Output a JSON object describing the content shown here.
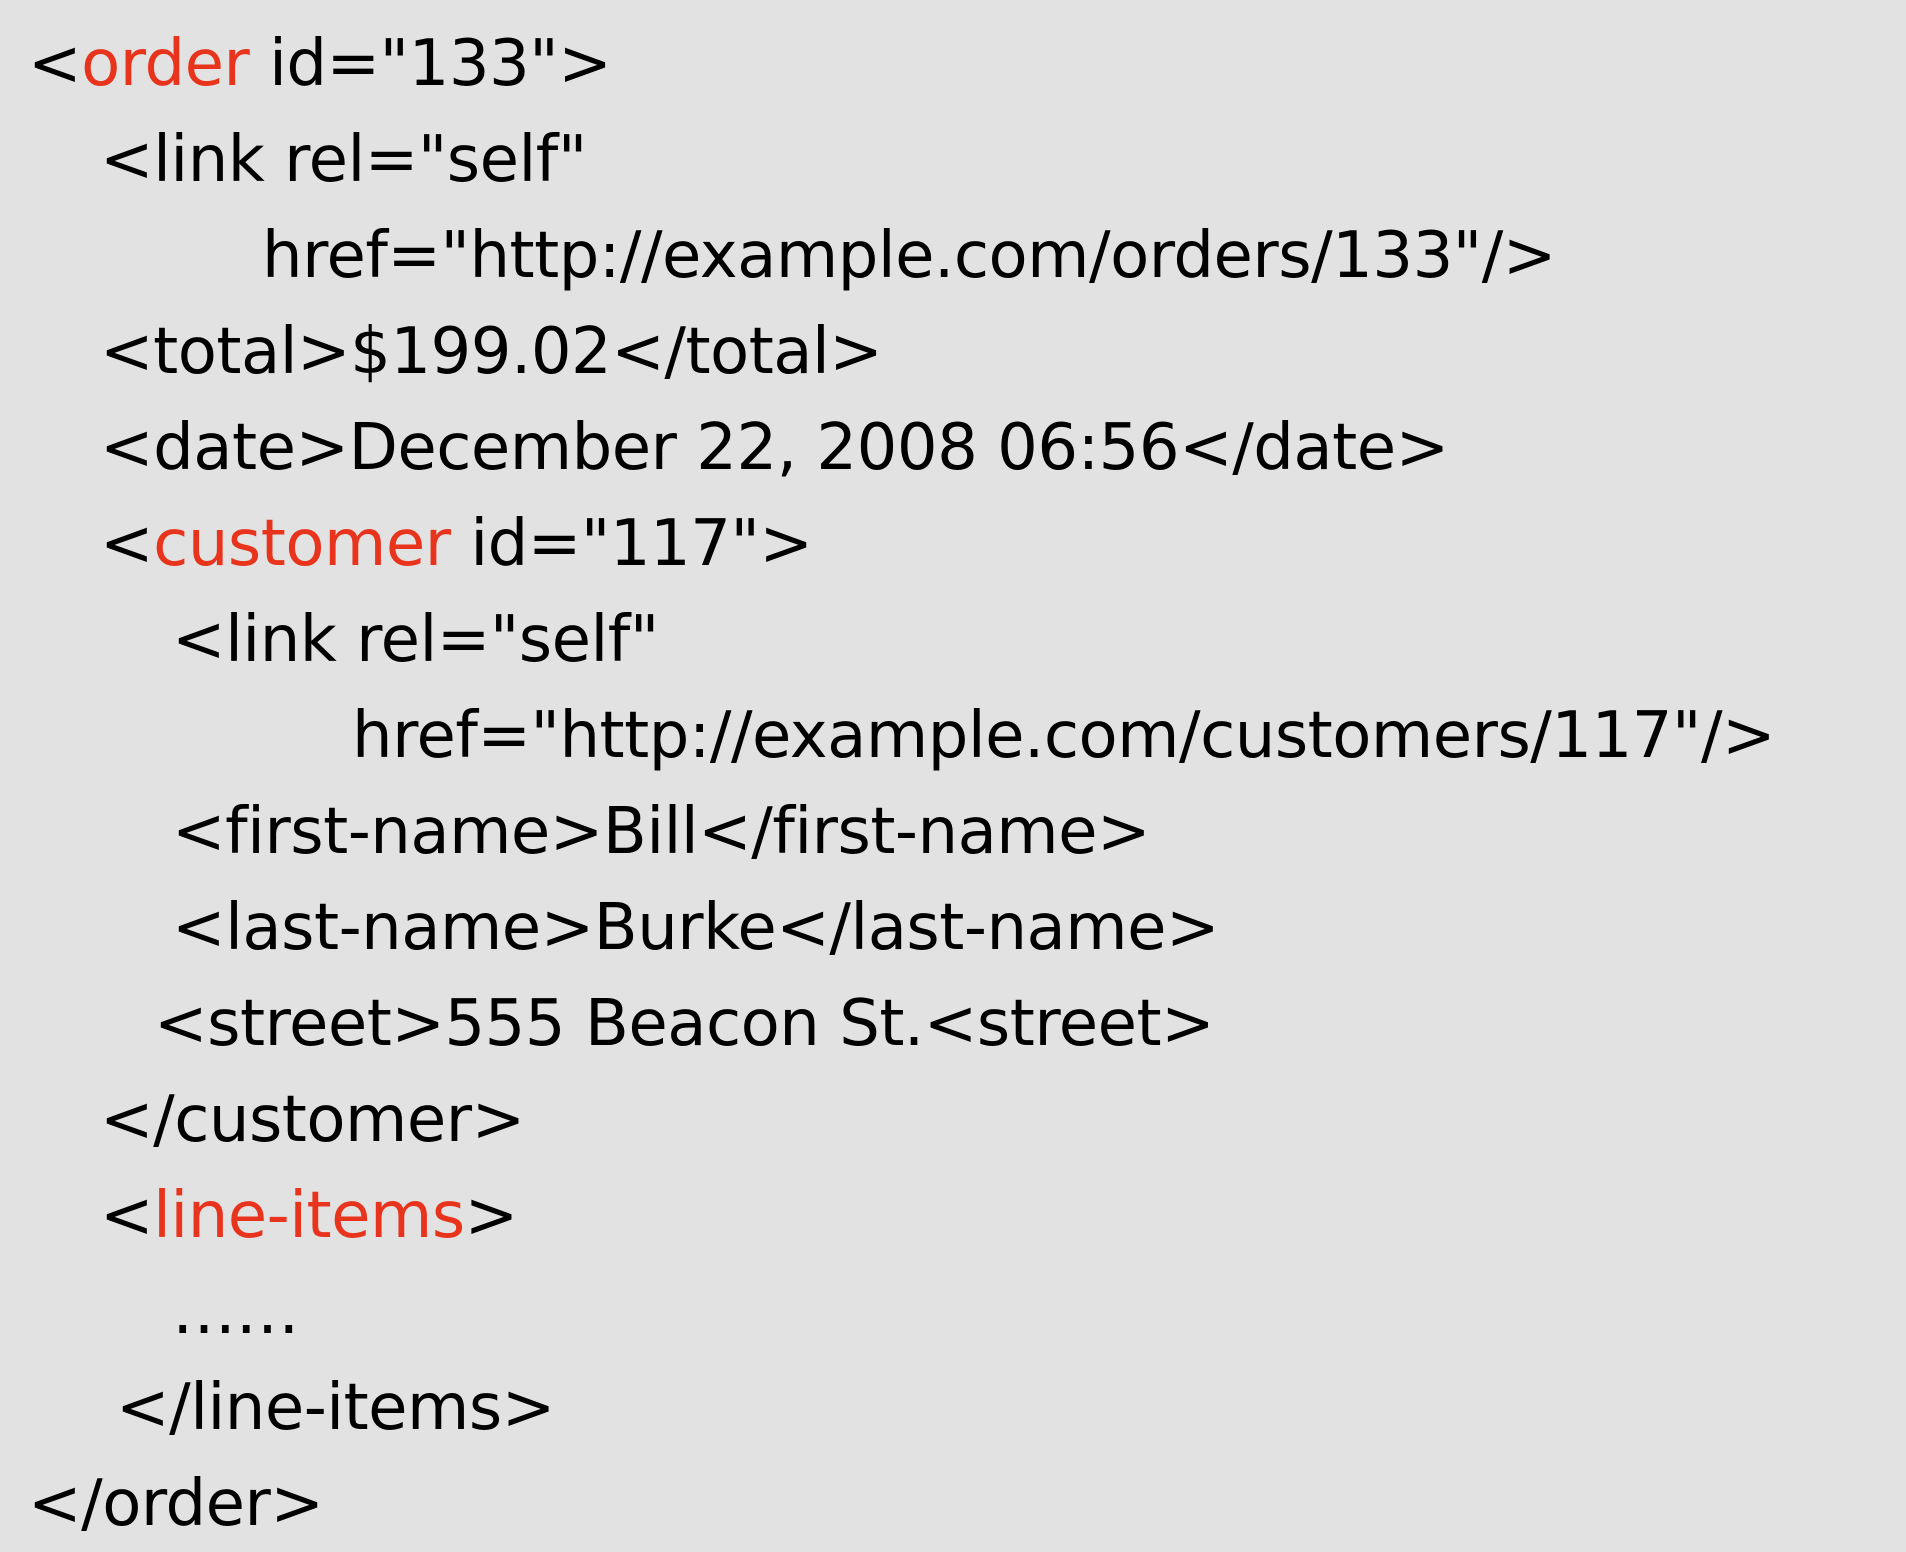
{
  "colors": {
    "background": "#e2e2e2",
    "text": "#000000",
    "highlight": "#e8341c"
  },
  "lines": [
    {
      "pre": "<",
      "kw": "order",
      "post": " id=\"133\">"
    },
    {
      "pre": "<link rel=\"self\"",
      "kw": "",
      "post": ""
    },
    {
      "pre": "href=\"http://example.com/orders/133\"/>",
      "kw": "",
      "post": ""
    },
    {
      "pre": "<total>$199.02</total>",
      "kw": "",
      "post": ""
    },
    {
      "pre": "<date>December 22, 2008 06:56</date>",
      "kw": "",
      "post": ""
    },
    {
      "pre": "<",
      "kw": "customer",
      "post": " id=\"117\">"
    },
    {
      "pre": "<link rel=\"self\"",
      "kw": "",
      "post": ""
    },
    {
      "pre": "href=\"http://example.com/customers/117\"/>",
      "kw": "",
      "post": ""
    },
    {
      "pre": "<first-name>Bill</first-name>",
      "kw": "",
      "post": ""
    },
    {
      "pre": "<last-name>Burke</last-name>",
      "kw": "",
      "post": ""
    },
    {
      "pre": "<street>555 Beacon St.<street>",
      "kw": "",
      "post": ""
    },
    {
      "pre": "</customer>",
      "kw": "",
      "post": ""
    },
    {
      "pre": "<",
      "kw": "line-items",
      "post": ">"
    },
    {
      "pre": "……",
      "kw": "",
      "post": ""
    },
    {
      "pre": "</line-items>",
      "kw": "",
      "post": ""
    },
    {
      "pre": "</order>",
      "kw": "",
      "post": ""
    }
  ]
}
